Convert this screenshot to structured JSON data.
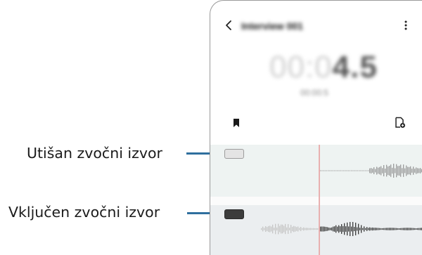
{
  "callouts": {
    "muted_source": "Utišan zvočni izvor",
    "active_source": "Vključen zvočni izvor"
  },
  "recording": {
    "title": "Interview 001",
    "elapsed_dim": "00:0",
    "elapsed_bold": "4.5",
    "subtime": "00:00:5"
  },
  "icons": {
    "back": "chevron-left-icon",
    "more": "more-vertical-icon",
    "bookmark": "bookmark-icon",
    "bookmark_list": "bookmark-list-icon"
  },
  "colors": {
    "leader_line": "#2f6f9e",
    "playhead": "#e8b0b0",
    "muted_chip": "#e4e4e4",
    "active_chip": "#3c3c3c",
    "track_background": "#eef3f2"
  }
}
